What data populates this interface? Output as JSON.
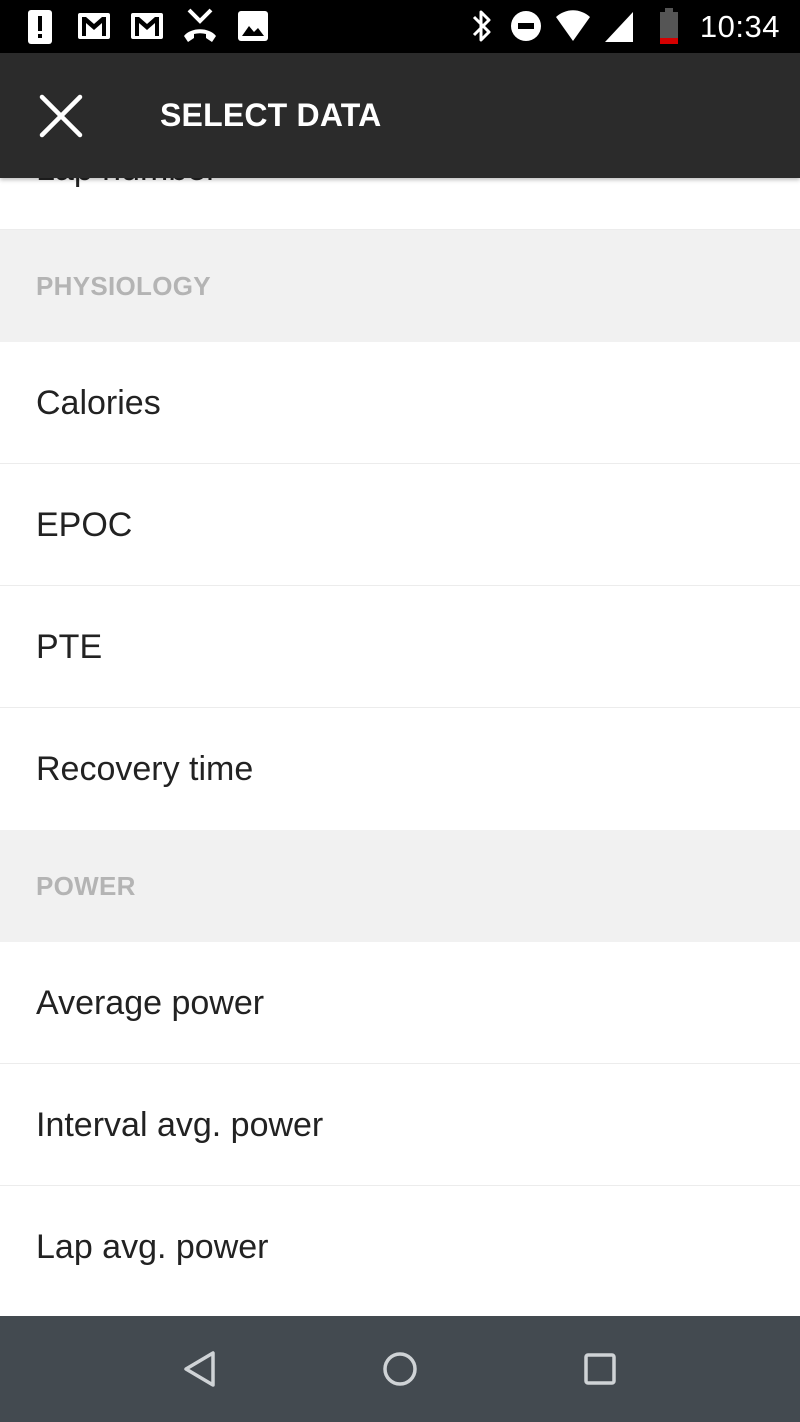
{
  "status_bar": {
    "time": "10:34",
    "left_icons": [
      "alert-icon",
      "gmail-icon",
      "gmail-icon",
      "missed-call-icon",
      "image-icon"
    ],
    "right_icons": [
      "bluetooth-icon",
      "do-not-disturb-icon",
      "wifi-icon",
      "cell-signal-icon",
      "battery-low-icon"
    ],
    "battery_color": "#d50000"
  },
  "app_bar": {
    "title": "SELECT DATA",
    "close_icon": "close-icon",
    "background": "#2b2b2b"
  },
  "list": {
    "partial_top_item": "Lap number",
    "sections": [
      {
        "header": "PHYSIOLOGY",
        "items": [
          "Calories",
          "EPOC",
          "PTE",
          "Recovery time"
        ]
      },
      {
        "header": "POWER",
        "items": [
          "Average power",
          "Interval avg. power",
          "Lap avg. power"
        ]
      }
    ]
  },
  "nav_bar": {
    "buttons": [
      "back-icon",
      "home-icon",
      "recents-icon"
    ],
    "background": "#434a50"
  }
}
